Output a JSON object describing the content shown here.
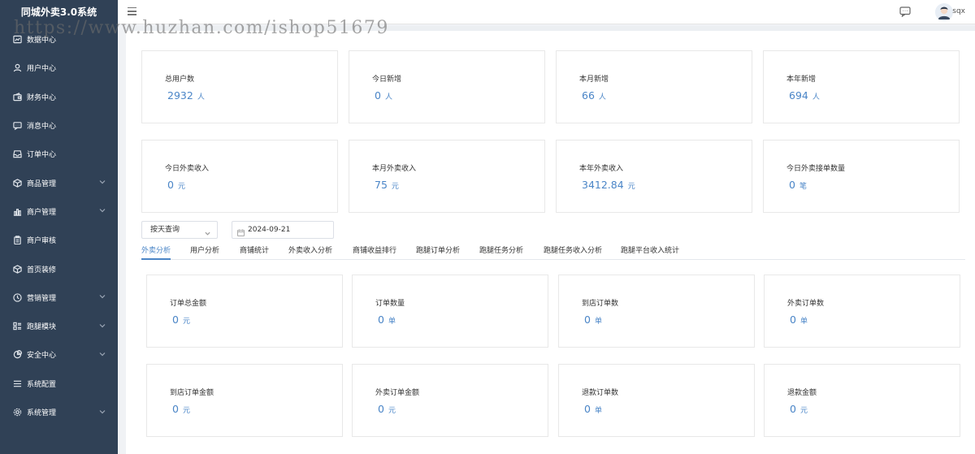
{
  "app": {
    "title": "同城外卖3.0系统"
  },
  "watermark": "https://www.huzhan.com/ishop51679",
  "sidebar": {
    "items": [
      {
        "label": "数据中心",
        "icon": "chart-icon",
        "expandable": false
      },
      {
        "label": "用户中心",
        "icon": "user-icon",
        "expandable": false
      },
      {
        "label": "财务中心",
        "icon": "wallet-icon",
        "expandable": false
      },
      {
        "label": "消息中心",
        "icon": "message-icon",
        "expandable": false
      },
      {
        "label": "订单中心",
        "icon": "inbox-icon",
        "expandable": false
      },
      {
        "label": "商品管理",
        "icon": "box-icon",
        "expandable": true
      },
      {
        "label": "商户管理",
        "icon": "bar-chart-icon",
        "expandable": true
      },
      {
        "label": "商户审核",
        "icon": "clipboard-icon",
        "expandable": false
      },
      {
        "label": "首页装修",
        "icon": "cube-icon",
        "expandable": false
      },
      {
        "label": "营销管理",
        "icon": "clock-icon",
        "expandable": true
      },
      {
        "label": "跑腿模块",
        "icon": "grid-list-icon",
        "expandable": true
      },
      {
        "label": "安全中心",
        "icon": "pie-icon",
        "expandable": true
      },
      {
        "label": "系统配置",
        "icon": "list-icon",
        "expandable": false
      },
      {
        "label": "系统管理",
        "icon": "gear-icon",
        "expandable": true
      }
    ]
  },
  "header": {
    "username": "sqx"
  },
  "stats_top": [
    {
      "label": "总用户数",
      "value": "2932",
      "unit": "人"
    },
    {
      "label": "今日新增",
      "value": "0",
      "unit": "人"
    },
    {
      "label": "本月新增",
      "value": "66",
      "unit": "人"
    },
    {
      "label": "本年新增",
      "value": "694",
      "unit": "人"
    },
    {
      "label": "今日外卖收入",
      "value": "0",
      "unit": "元"
    },
    {
      "label": "本月外卖收入",
      "value": "75",
      "unit": "元"
    },
    {
      "label": "本年外卖收入",
      "value": "3412.84",
      "unit": "元"
    },
    {
      "label": "今日外卖接单数量",
      "value": "0",
      "unit": "笔"
    }
  ],
  "filter": {
    "mode": "按天查询",
    "date": "2024-09-21"
  },
  "tabs": [
    {
      "label": "外卖分析",
      "active": true
    },
    {
      "label": "用户分析",
      "active": false
    },
    {
      "label": "商铺统计",
      "active": false
    },
    {
      "label": "外卖收入分析",
      "active": false
    },
    {
      "label": "商铺收益排行",
      "active": false
    },
    {
      "label": "跑腿订单分析",
      "active": false
    },
    {
      "label": "跑腿任务分析",
      "active": false
    },
    {
      "label": "跑腿任务收入分析",
      "active": false
    },
    {
      "label": "跑腿平台收入统计",
      "active": false
    }
  ],
  "stats_bottom": [
    {
      "label": "订单总金额",
      "value": "0",
      "unit": "元"
    },
    {
      "label": "订单数量",
      "value": "0",
      "unit": "单"
    },
    {
      "label": "到店订单数",
      "value": "0",
      "unit": "单"
    },
    {
      "label": "外卖订单数",
      "value": "0",
      "unit": "单"
    },
    {
      "label": "到店订单金额",
      "value": "0",
      "unit": "元"
    },
    {
      "label": "外卖订单金额",
      "value": "0",
      "unit": "元"
    },
    {
      "label": "退款订单数",
      "value": "0",
      "unit": "单"
    },
    {
      "label": "退款金额",
      "value": "0",
      "unit": "元"
    }
  ],
  "colors": {
    "sidebar_bg": "#304156",
    "accent": "#4a85c7",
    "page_bg": "#f0f2f5"
  }
}
